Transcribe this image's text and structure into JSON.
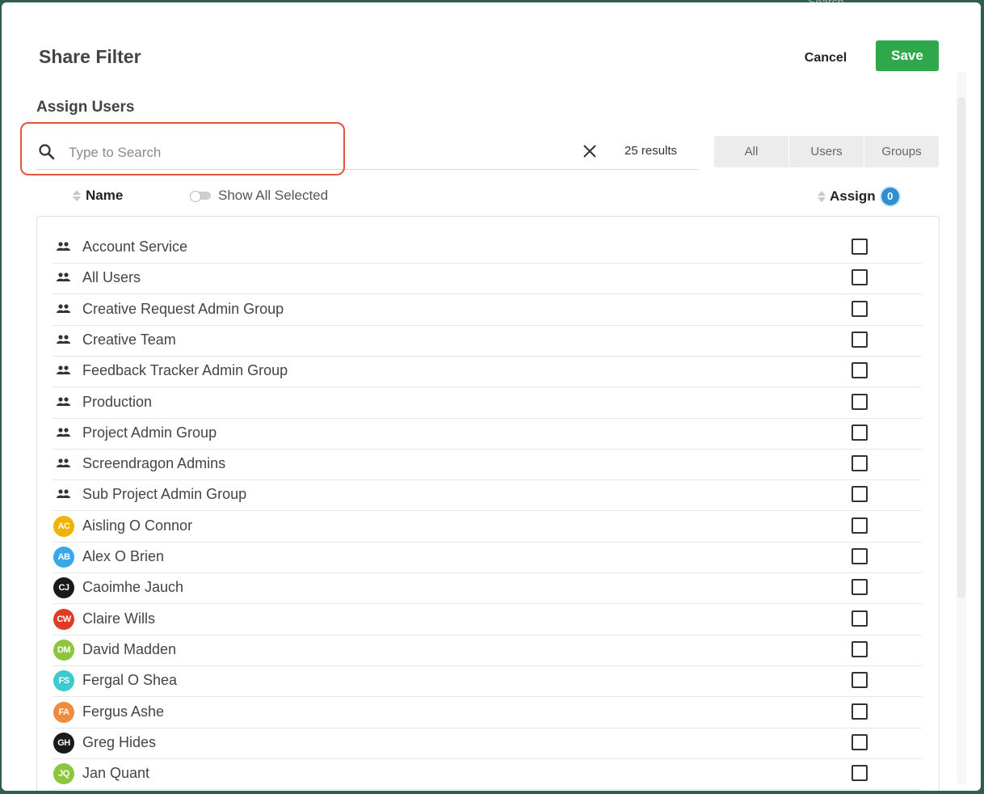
{
  "backdrop": {
    "search_text": "Search..."
  },
  "dialog": {
    "title": "Share Filter",
    "cancel_label": "Cancel",
    "save_label": "Save",
    "section_title": "Assign Users"
  },
  "search": {
    "placeholder": "Type to Search",
    "value": "",
    "results_text": "25 results"
  },
  "filter_tabs": [
    "All",
    "Users",
    "Groups"
  ],
  "columns": {
    "name_label": "Name",
    "show_all_selected_label": "Show All Selected",
    "assign_label": "Assign",
    "assign_count": "0"
  },
  "colors": {
    "save_button": "#2ea84a",
    "highlight_border": "#e0553e",
    "assign_badge": "#2f8fd0"
  },
  "items": [
    {
      "type": "group",
      "label": "Account Service"
    },
    {
      "type": "group",
      "label": "All Users"
    },
    {
      "type": "group",
      "label": "Creative Request Admin Group"
    },
    {
      "type": "group",
      "label": "Creative Team"
    },
    {
      "type": "group",
      "label": "Feedback Tracker Admin Group"
    },
    {
      "type": "group",
      "label": "Production"
    },
    {
      "type": "group",
      "label": "Project Admin Group"
    },
    {
      "type": "group",
      "label": "Screendragon Admins"
    },
    {
      "type": "group",
      "label": "Sub Project Admin Group"
    },
    {
      "type": "user",
      "label": "Aisling O Connor",
      "initials": "AC",
      "color": "#f0b400"
    },
    {
      "type": "user",
      "label": "Alex O Brien",
      "initials": "AB",
      "color": "#3aa8e8"
    },
    {
      "type": "user",
      "label": "Caoimhe Jauch",
      "initials": "CJ",
      "color": "#1a1a1a"
    },
    {
      "type": "user",
      "label": "Claire Wills",
      "initials": "CW",
      "color": "#e03b24"
    },
    {
      "type": "user",
      "label": "David Madden",
      "initials": "DM",
      "color": "#8cc63e"
    },
    {
      "type": "user",
      "label": "Fergal O Shea",
      "initials": "FS",
      "color": "#3ec9cf"
    },
    {
      "type": "user",
      "label": "Fergus Ashe",
      "initials": "FA",
      "color": "#f08a3c"
    },
    {
      "type": "user",
      "label": "Greg Hides",
      "initials": "GH",
      "color": "#1a1a1a"
    },
    {
      "type": "user",
      "label": "Jan Quant",
      "initials": "JQ",
      "color": "#8cc63e"
    }
  ]
}
